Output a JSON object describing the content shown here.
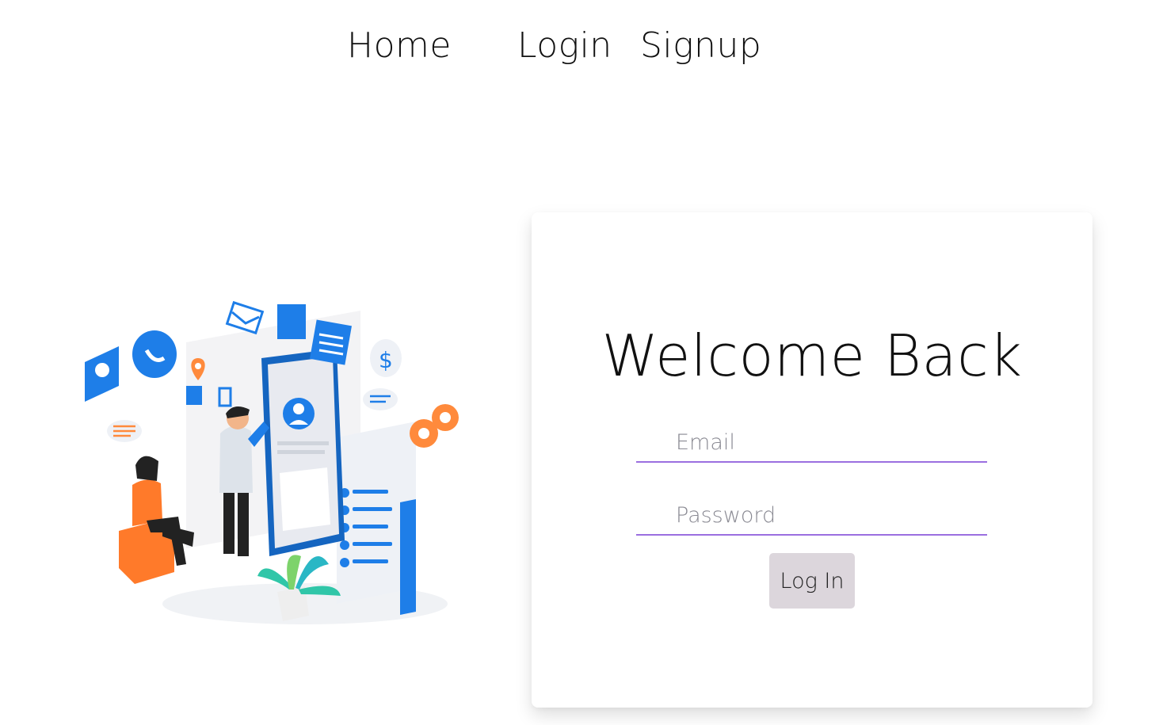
{
  "nav": {
    "home_label": "Home",
    "login_label": "Login",
    "signup_label": "Signup"
  },
  "login_card": {
    "title": "Welcome Back",
    "email_placeholder": "Email",
    "password_placeholder": "Password",
    "login_button": "Log In"
  },
  "illustration": {
    "icon": "isometric-mobile-app-illustration"
  },
  "colors": {
    "accent": "#9b6fe0",
    "button_bg": "#dcd6dc",
    "illustration_blue": "#1976e8",
    "illustration_orange": "#ff8a3c"
  }
}
